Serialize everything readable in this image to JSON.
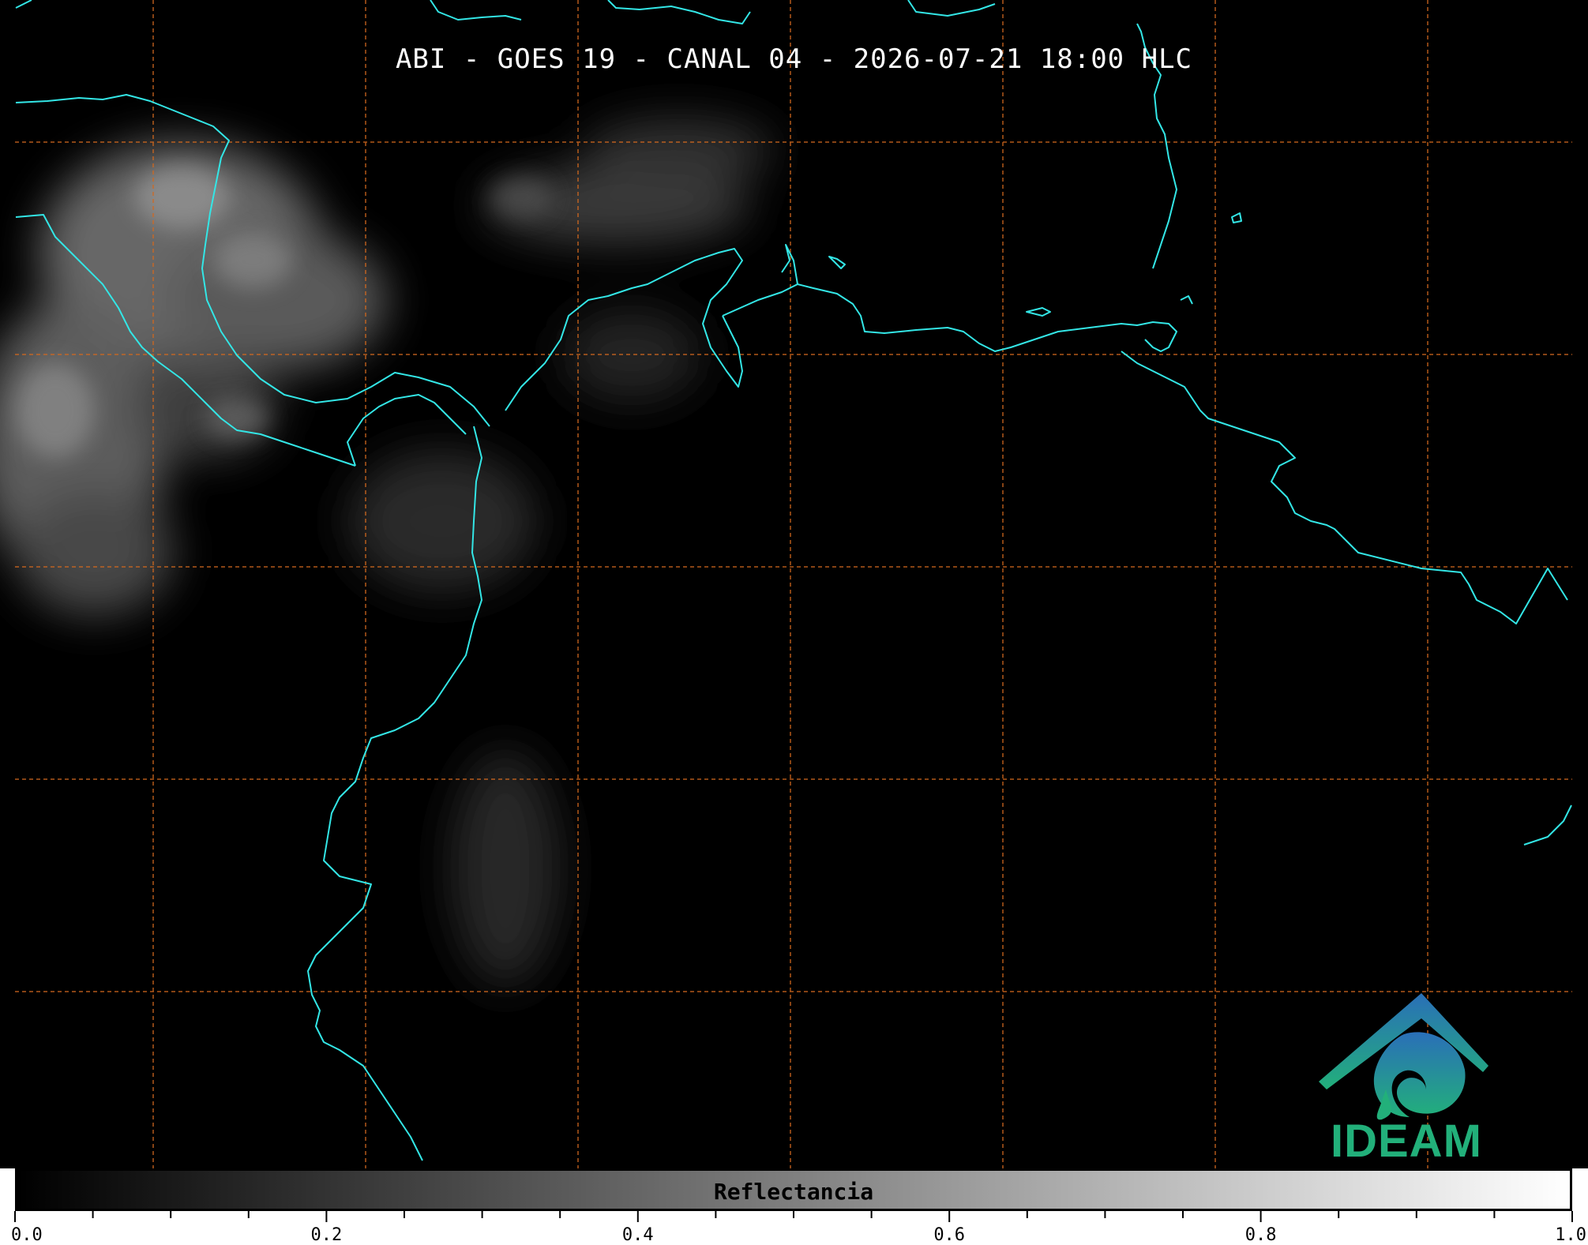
{
  "map": {
    "title": "ABI - GOES 19 - CANAL 04 - 2026-07-21 18:00 HLC",
    "background_color": "#000000",
    "coastline_color": "#33e6e6",
    "gridline_color": "#d2691e",
    "logo": {
      "icon": "ideam-logo-icon",
      "text": "IDEAM",
      "color_top": "#2a6fb8",
      "color_bottom": "#22b07a"
    }
  },
  "colorbar": {
    "label": "Reflectancia",
    "range": [
      0.0,
      1.0
    ],
    "tick_labels": [
      "0.0",
      "0.2",
      "0.4",
      "0.6",
      "0.8",
      "1.0"
    ],
    "color_start": "#000000",
    "color_end": "#ffffff"
  }
}
